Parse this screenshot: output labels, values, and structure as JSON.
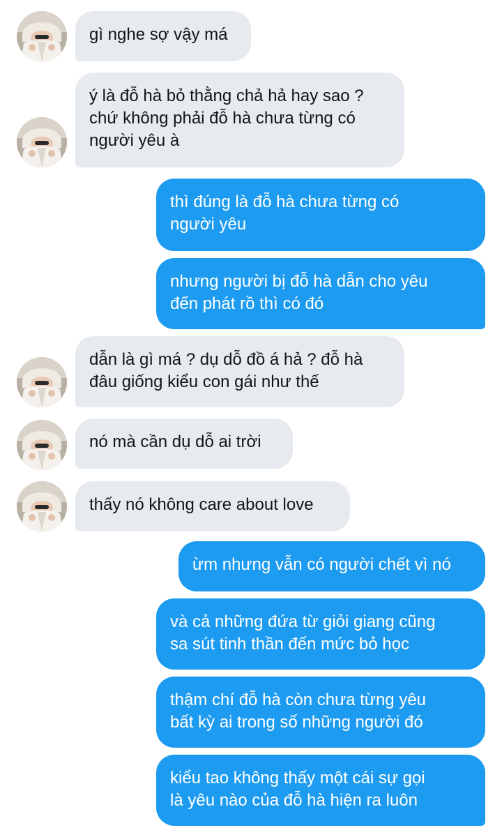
{
  "messages": [
    {
      "sender": "other",
      "text": "gì nghe sợ vậy má"
    },
    {
      "sender": "other",
      "text": "ý là đỗ hà bỏ thằng chả hả hay sao ?\nchứ không phải đỗ hà chưa từng có\nngười yêu à"
    },
    {
      "sender": "me",
      "text": "thì đúng là đỗ hà chưa từng có\nngười yêu"
    },
    {
      "sender": "me",
      "text": "nhưng người bị đỗ hà dẫn cho yêu\nđến phát rồ thì có đó"
    },
    {
      "sender": "other",
      "text": "dẫn là gì má ? dụ dỗ đồ á hả ? đỗ hà\nđâu giống kiểu con gái như thế"
    },
    {
      "sender": "other",
      "text": "nó mà cần dụ dỗ ai trời"
    },
    {
      "sender": "other",
      "text": "thấy nó không care about love"
    },
    {
      "sender": "me",
      "text": "ừm nhưng vẫn có người chết vì nó"
    },
    {
      "sender": "me",
      "text": "và cả những đứa từ giỏi giang cũng\nsa sút tinh thần đến mức bỏ học"
    },
    {
      "sender": "me",
      "text": "thậm chí đỗ hà còn chưa từng yêu\nbất kỳ ai trong số những người đó"
    },
    {
      "sender": "me",
      "text": "kiểu tao không thấy một cái sự gọi\nlà yêu nào của đỗ hà hiện ra luôn"
    }
  ],
  "colors": {
    "incoming_bubble": "#e7ebef",
    "incoming_text": "#141414",
    "outgoing_bubble": "#1d9bf0",
    "outgoing_text": "#ffffff"
  },
  "icons": {
    "avatar": "avatar-photo-icon"
  }
}
